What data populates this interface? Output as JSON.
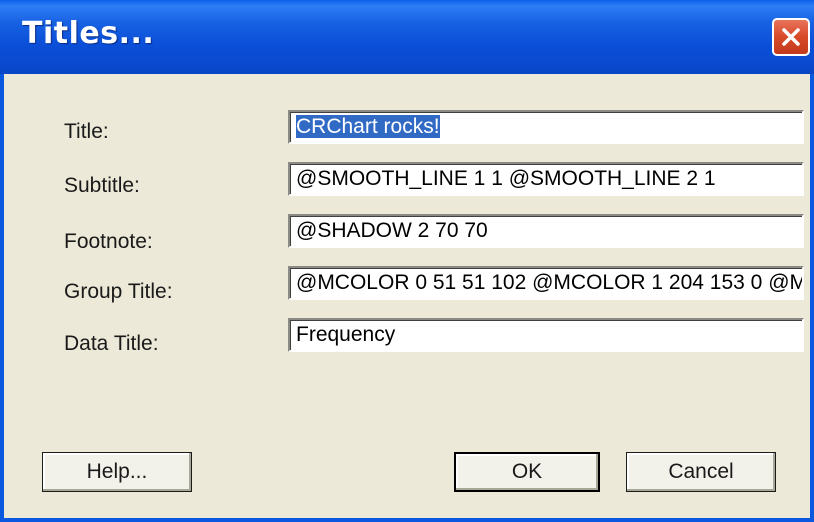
{
  "window": {
    "title": "Titles..."
  },
  "fields": [
    {
      "label": "Title:",
      "value": "CRChart rocks!"
    },
    {
      "label": "Subtitle:",
      "value": "@SMOOTH_LINE 1 1 @SMOOTH_LINE 2 1"
    },
    {
      "label": "Footnote:",
      "value": "@SHADOW 2 70 70"
    },
    {
      "label": "Group Title:",
      "value": "@MCOLOR 0 51 51 102 @MCOLOR 1 204 153 0 @M"
    },
    {
      "label": "Data Title:",
      "value": "Frequency"
    }
  ],
  "buttons": {
    "help": "Help...",
    "ok": "OK",
    "cancel": "Cancel"
  },
  "icons": {
    "close": "close-icon"
  },
  "colors": {
    "titlebar": "#0a4ad0",
    "close_button": "#d84a28",
    "selection": "#316ac5",
    "dialog_background": "#ece9d8"
  }
}
